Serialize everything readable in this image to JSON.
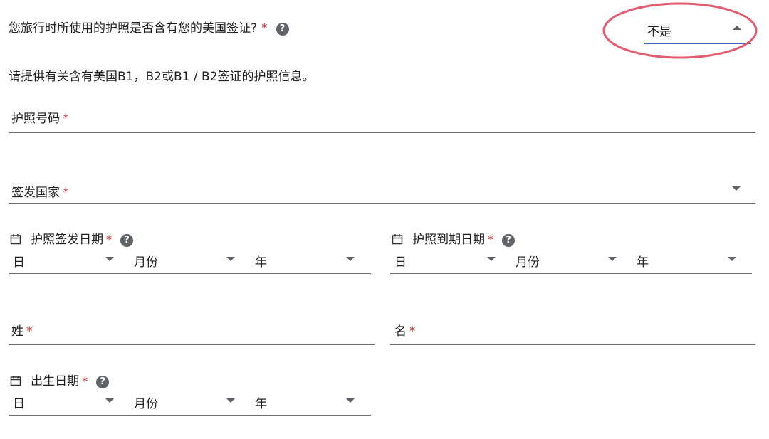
{
  "question": {
    "text": "您旅行时所使用的护照是否含有您的美国签证?",
    "required_mark": "*",
    "help_glyph": "?"
  },
  "visa_select": {
    "value": "不是",
    "accent_color": "#3b5bb5",
    "highlight_color": "#e35b6e"
  },
  "info_text": "请提供有关含有美国B1，B2或B1 / B2签证的护照信息。",
  "passport_number": {
    "label": "护照号码",
    "required_mark": "*"
  },
  "issuing_country": {
    "label": "签发国家",
    "required_mark": "*"
  },
  "issue_date": {
    "label": "护照签发日期",
    "required_mark": "*",
    "help_glyph": "?",
    "day": "日",
    "month": "月份",
    "year": "年"
  },
  "expiry_date": {
    "label": "护照到期日期",
    "required_mark": "*",
    "help_glyph": "?",
    "day": "日",
    "month": "月份",
    "year": "年"
  },
  "surname": {
    "label": "姓",
    "required_mark": "*"
  },
  "given_name": {
    "label": "名",
    "required_mark": "*"
  },
  "birth_date": {
    "label": "出生日期",
    "required_mark": "*",
    "help_glyph": "?",
    "day": "日",
    "month": "月份",
    "year": "年"
  }
}
